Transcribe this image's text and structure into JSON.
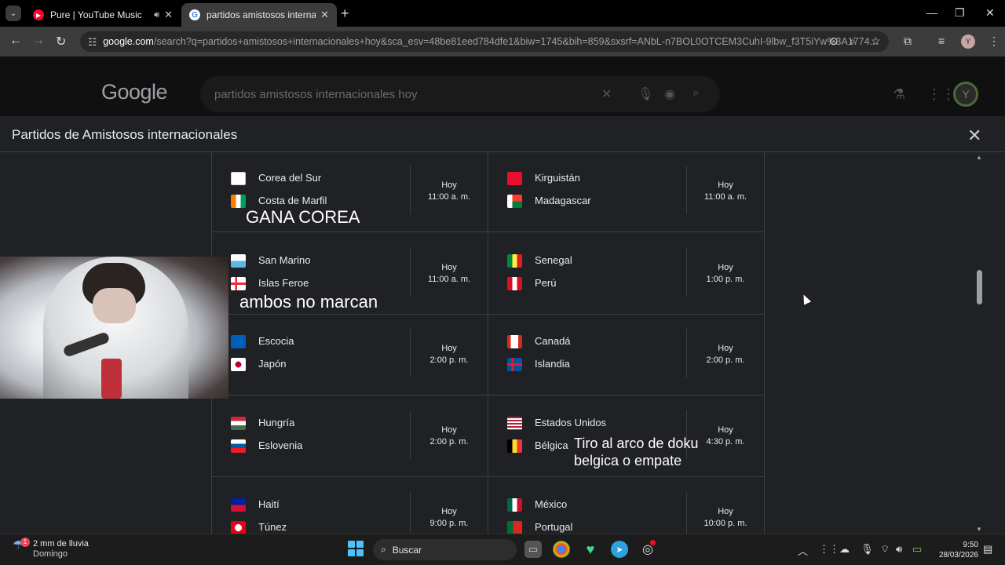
{
  "browser": {
    "tabs": [
      {
        "title": "Pure | YouTube Music",
        "active": false
      },
      {
        "title": "partidos amistosos internacionales",
        "active": true
      }
    ],
    "url_site": "google.com",
    "url_rest": "/search?q=partidos+amistosos+internacionales+hoy&sca_esv=48be81eed784dfe1&biw=1745&bih=859&sxsrf=ANbL-n7BOL0OTCEM3CuhI-9lbw_f3T5iYw%3A1774...",
    "profile_initial": "Y"
  },
  "google": {
    "logo": "Google",
    "query": "partidos amistosos internacionales hoy",
    "profile_initial": "Y"
  },
  "panel": {
    "title": "Partidos de Amistosos internacionales",
    "matches": [
      {
        "home": "Corea del Sur",
        "away": "Costa de Marfil",
        "day": "Hoy",
        "time": "11:00 a. m.",
        "home_flag": "kr",
        "away_flag": "ci"
      },
      {
        "home": "Kirguistán",
        "away": "Madagascar",
        "day": "Hoy",
        "time": "11:00 a. m.",
        "home_flag": "kg",
        "away_flag": "mg"
      },
      {
        "home": "San Marino",
        "away": "Islas Feroe",
        "day": "Hoy",
        "time": "11:00 a. m.",
        "home_flag": "sm",
        "away_flag": "fo"
      },
      {
        "home": "Senegal",
        "away": "Perú",
        "day": "Hoy",
        "time": "1:00 p. m.",
        "home_flag": "sn",
        "away_flag": "pe"
      },
      {
        "home": "Escocia",
        "away": "Japón",
        "day": "Hoy",
        "time": "2:00 p. m.",
        "home_flag": "sco",
        "away_flag": "jp"
      },
      {
        "home": "Canadá",
        "away": "Islandia",
        "day": "Hoy",
        "time": "2:00 p. m.",
        "home_flag": "ca",
        "away_flag": "is"
      },
      {
        "home": "Hungría",
        "away": "Eslovenia",
        "day": "Hoy",
        "time": "2:00 p. m.",
        "home_flag": "hu",
        "away_flag": "si"
      },
      {
        "home": "Estados Unidos",
        "away": "Bélgica",
        "day": "Hoy",
        "time": "4:30 p. m.",
        "home_flag": "us",
        "away_flag": "be"
      },
      {
        "home": "Haití",
        "away": "Túnez",
        "day": "Hoy",
        "time": "9:00 p. m.",
        "home_flag": "ht",
        "away_flag": "tn"
      },
      {
        "home": "México",
        "away": "Portugal",
        "day": "Hoy",
        "time": "10:00 p. m.",
        "home_flag": "mx",
        "away_flag": "pt"
      }
    ]
  },
  "captions": {
    "c1": "GANA COREA",
    "c2": "ambos no marcan",
    "c3a": "Tiro al arco de doku",
    "c3b": "belgica o empate"
  },
  "taskbar": {
    "weather_line1": "2 mm de lluvia",
    "weather_line2": "Domingo",
    "weather_badge": "1",
    "search_label": "Buscar",
    "time": "9:50",
    "date": "28/03/2026"
  }
}
